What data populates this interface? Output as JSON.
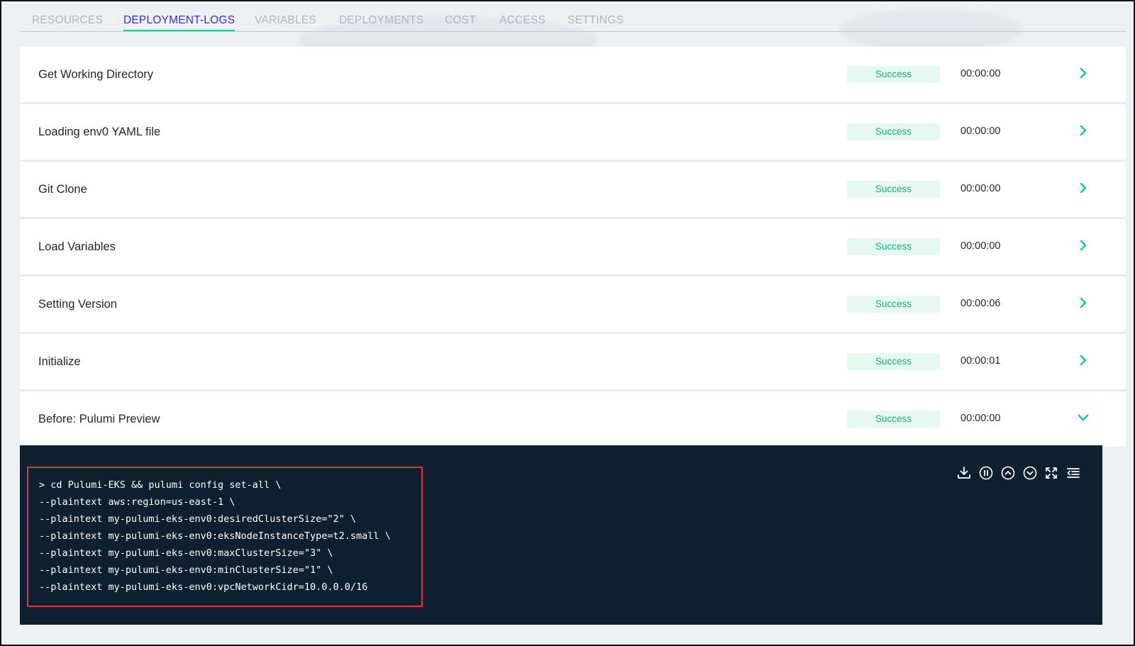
{
  "tabs": [
    {
      "label": "RESOURCES"
    },
    {
      "label": "DEPLOYMENT-LOGS"
    },
    {
      "label": "VARIABLES"
    },
    {
      "label": "DEPLOYMENTS"
    },
    {
      "label": "COST"
    },
    {
      "label": "ACCESS"
    },
    {
      "label": "SETTINGS"
    }
  ],
  "active_tab": "DEPLOYMENT-LOGS",
  "steps": [
    {
      "name": "Get Working Directory",
      "status": "Success",
      "duration": "00:00:00",
      "expanded": false
    },
    {
      "name": "Loading env0 YAML file",
      "status": "Success",
      "duration": "00:00:00",
      "expanded": false
    },
    {
      "name": "Git Clone",
      "status": "Success",
      "duration": "00:00:00",
      "expanded": false
    },
    {
      "name": "Load Variables",
      "status": "Success",
      "duration": "00:00:00",
      "expanded": false
    },
    {
      "name": "Setting Version",
      "status": "Success",
      "duration": "00:00:06",
      "expanded": false
    },
    {
      "name": "Initialize",
      "status": "Success",
      "duration": "00:00:01",
      "expanded": false
    },
    {
      "name": "Before: Pulumi Preview",
      "status": "Success",
      "duration": "00:00:00",
      "expanded": true
    }
  ],
  "terminal": {
    "lines": [
      "> cd Pulumi-EKS && pulumi config set-all \\",
      "--plaintext aws:region=us-east-1 \\",
      "--plaintext my-pulumi-eks-env0:desiredClusterSize=\"2\" \\",
      "--plaintext my-pulumi-eks-env0:eksNodeInstanceType=t2.small \\",
      "--plaintext my-pulumi-eks-env0:maxClusterSize=\"3\" \\",
      "--plaintext my-pulumi-eks-env0:minClusterSize=\"1\" \\",
      "--plaintext my-pulumi-eks-env0:vpcNetworkCidr=10.0.0.0/16"
    ],
    "tools": [
      "download-icon",
      "pause-icon",
      "scroll-up-icon",
      "scroll-down-icon",
      "fullscreen-icon",
      "collapse-lines-icon"
    ]
  },
  "colors": {
    "accent": "#1fc59a",
    "active_tab": "#3b2fc9",
    "terminal_bg": "#0e1f2f",
    "highlight": "#e0383a",
    "status_bg": "#e5f9f1",
    "status_text": "#1aaa76"
  }
}
